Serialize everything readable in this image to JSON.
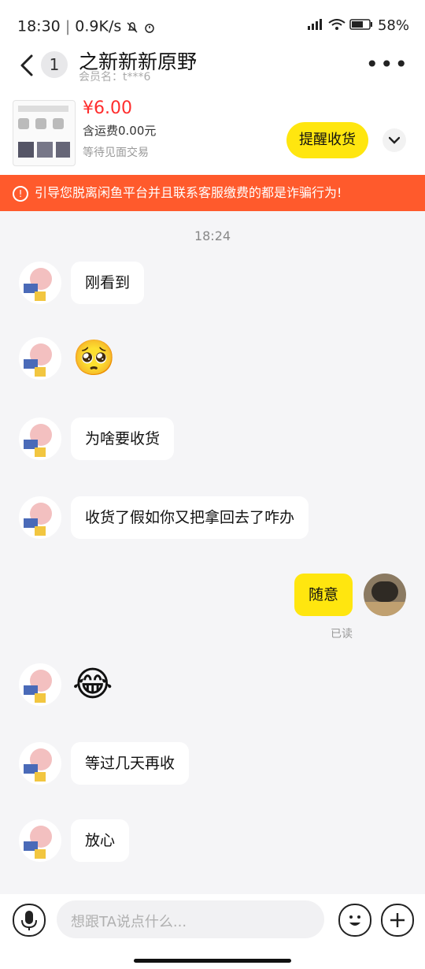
{
  "status_bar": {
    "time": "18:30",
    "speed": "0.9K/s",
    "battery": "58%"
  },
  "header": {
    "back_badge": "1",
    "title": "之新新新原野",
    "member": "会员名：t***6"
  },
  "product": {
    "price": "¥6.00",
    "note": "含运费0.00元",
    "status": "等待见面交易",
    "remind_button": "提醒收货"
  },
  "warning": {
    "text": "引导您脱离闲鱼平台并且联系客服缴费的都是诈骗行为!"
  },
  "chat": {
    "timestamp": "18:24",
    "messages": [
      {
        "type": "text",
        "text": "刚看到"
      },
      {
        "type": "emoji",
        "emoji": "🥺"
      },
      {
        "type": "text",
        "text": "为啥要收货"
      },
      {
        "type": "text",
        "text": "收货了假如你又把拿回去了咋办"
      },
      {
        "type": "text_me",
        "text": "随意",
        "status": "已读"
      },
      {
        "type": "emoji",
        "emoji": "😂"
      },
      {
        "type": "text",
        "text": "等过几天再收"
      },
      {
        "type": "text",
        "text": "放心"
      }
    ]
  },
  "input": {
    "placeholder": "想跟TA说点什么..."
  },
  "colors": {
    "accent_yellow": "#ffe60f",
    "warning_orange": "#ff5a2c",
    "price_red": "#ff2d2d"
  }
}
